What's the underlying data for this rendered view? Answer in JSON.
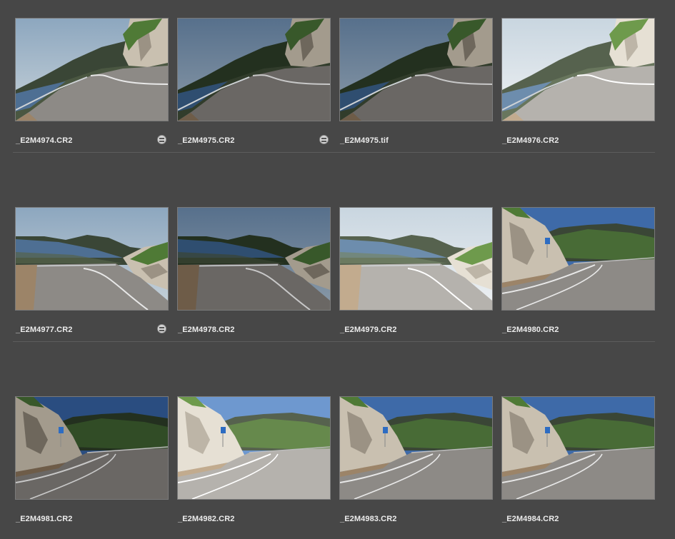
{
  "rows": [
    {
      "items": [
        {
          "filename": "_E2M4974.CR2",
          "has_badge": true,
          "scene": "coast-left",
          "tone": "normal",
          "badge_icon": "adjustment-badge-icon"
        },
        {
          "filename": "_E2M4975.CR2",
          "has_badge": true,
          "scene": "coast-left",
          "tone": "dark"
        },
        {
          "filename": "_E2M4975.tif",
          "has_badge": false,
          "scene": "coast-left",
          "tone": "dark"
        },
        {
          "filename": "_E2M4976.CR2",
          "has_badge": false,
          "scene": "coast-left",
          "tone": "bright"
        }
      ]
    },
    {
      "items": [
        {
          "filename": "_E2M4977.CR2",
          "has_badge": true,
          "scene": "coast-right",
          "tone": "normal"
        },
        {
          "filename": "_E2M4978.CR2",
          "has_badge": false,
          "scene": "coast-right",
          "tone": "dark"
        },
        {
          "filename": "_E2M4979.CR2",
          "has_badge": false,
          "scene": "coast-right",
          "tone": "bright"
        },
        {
          "filename": "_E2M4980.CR2",
          "has_badge": false,
          "scene": "cliff-road",
          "tone": "normal"
        }
      ]
    },
    {
      "items": [
        {
          "filename": "_E2M4981.CR2",
          "has_badge": false,
          "scene": "cliff-road",
          "tone": "dark"
        },
        {
          "filename": "_E2M4982.CR2",
          "has_badge": false,
          "scene": "cliff-road",
          "tone": "bright"
        },
        {
          "filename": "_E2M4983.CR2",
          "has_badge": false,
          "scene": "cliff-road",
          "tone": "normal"
        },
        {
          "filename": "_E2M4984.CR2",
          "has_badge": false,
          "scene": "cliff-road",
          "tone": "normal"
        }
      ]
    }
  ],
  "colors": {
    "background": "#474747",
    "thumbnail_border": "#7a7a7a",
    "filename_text": "#ececec",
    "separator": "#5d5d5d"
  }
}
